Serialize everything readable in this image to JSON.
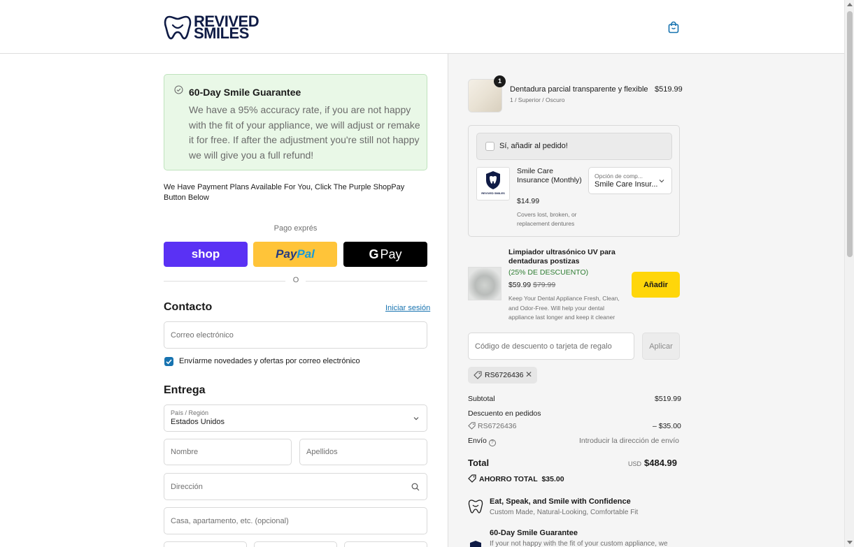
{
  "header": {
    "brand_line1": "REVIVED",
    "brand_line2": "SMILES",
    "brand_color": "#0f1b45",
    "cart_icon": "shopping-bag-icon"
  },
  "guarantee": {
    "title": "60-Day Smile Guarantee",
    "body": "We have a 95% accuracy rate, if you are not happy with the fit of your appliance, we will adjust or remake it for free. If after the adjustment you're still not happy we will give you a full refund!"
  },
  "plans_note": "We Have Payment Plans Available For You, Click The Purple ShopPay Button Below",
  "express": {
    "label": "Pago exprés",
    "shop_label": "shop",
    "paypal_part1": "Pay",
    "paypal_part2": "Pal",
    "gpay_g": "G",
    "gpay_label": "Pay",
    "divider": "O"
  },
  "contact": {
    "heading": "Contacto",
    "login_link": "Iniciar sesión",
    "email_placeholder": "Correo electrónico",
    "newsletter_label": "Envíarme novedades y ofertas por correo electrónico",
    "newsletter_checked": true
  },
  "delivery": {
    "heading": "Entrega",
    "country_label": "País / Región",
    "country_value": "Estados Unidos",
    "first_name": "Nombre",
    "last_name": "Apellidos",
    "address": "Dirección",
    "apartment": "Casa, apartamento, etc. (opcional)"
  },
  "cart": {
    "item": {
      "name": "Dentadura parcial transparente y flexible",
      "variant": "1 / Superior / Oscuro",
      "price": "$519.99",
      "quantity": "1"
    },
    "insurance": {
      "add_label": "Sí, añadir al pedido!",
      "name": "Smile Care Insurance (Monthly)",
      "price": "$14.99",
      "desc": "Covers lost, broken, or replacement dentures",
      "select_label": "Opción de comp...",
      "select_value": "Smile Care Insur...",
      "logo_text": "REVIVED SMILES"
    },
    "cleaner": {
      "name": "Limpiador ultrasónico UV para dentaduras postizas",
      "discount": "(25% DE DESCUENTO)",
      "price": "$59.99",
      "old_price": "$79.99",
      "desc": "Keep Your Dental Appliance Fresh, Clean, and Odor-Free. Will help your dental appliance last longer and keep it cleaner",
      "add_label": "Añadir"
    },
    "discount_placeholder": "Código de descuento o tarjeta de regalo",
    "apply_label": "Aplicar",
    "applied_code": "RS6726436",
    "applied_remove": "✕"
  },
  "summary": {
    "subtotal_label": "Subtotal",
    "subtotal_value": "$519.99",
    "order_discount_label": "Descuento en pedidos",
    "discount_code": "RS6726436",
    "discount_value": "– $35.00",
    "shipping_label": "Envío",
    "shipping_value": "Introducir la dirección de envío",
    "total_label": "Total",
    "currency": "USD",
    "total_value": "$484.99",
    "savings_label": "AHORRO TOTAL",
    "savings_value": "$35.00"
  },
  "features": [
    {
      "title": "Eat, Speak, and Smile with Confidence",
      "body": "Custom Made, Natural-Looking, Comfortable Fit"
    },
    {
      "title": "60-Day Smile Guarantee",
      "body": "If your not happy with the fit of your custom appliance, we"
    }
  ],
  "colors": {
    "shop_purple": "#5a31f4",
    "paypal_yellow": "#ffc439",
    "add_button_yellow": "#ffd60a",
    "guarantee_bg": "#e9f8e7",
    "link_blue": "#1773b0"
  }
}
